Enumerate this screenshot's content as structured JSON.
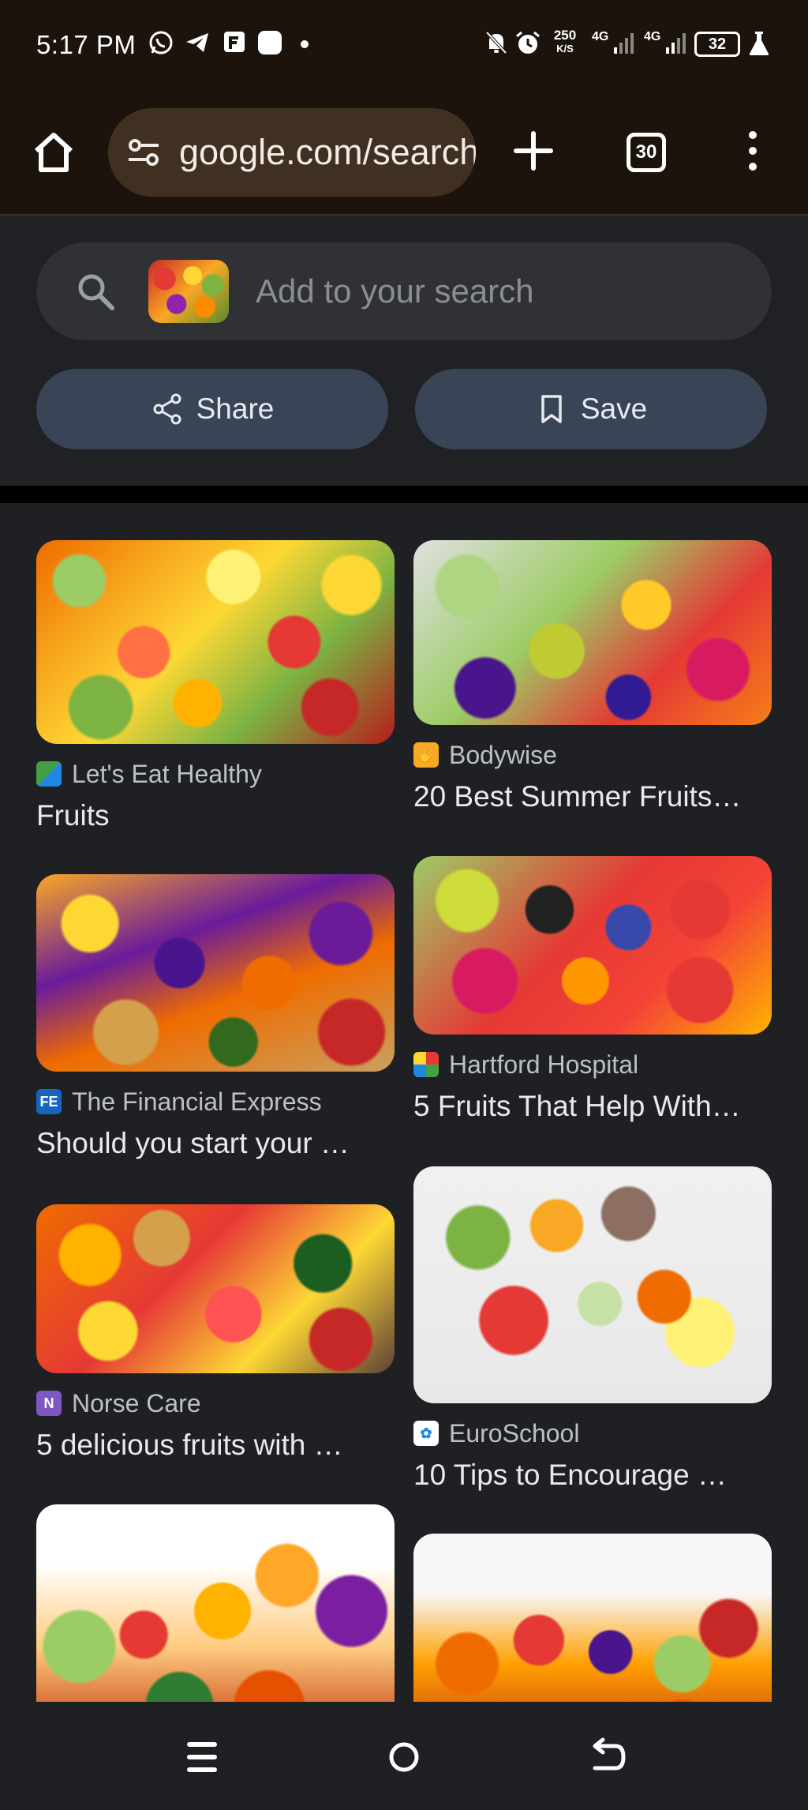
{
  "status_bar": {
    "time": "5:17 PM",
    "net_speed_value": "250",
    "net_speed_unit": "K/S",
    "sim1": "4G",
    "sim2": "4G",
    "battery": "32",
    "left_icons": [
      "whatsapp-icon",
      "telegram-icon",
      "flipboard-icon",
      "app-square-icon",
      "dot-icon"
    ],
    "right_icons": [
      "mute-icon",
      "alarm-icon",
      "signal-icon",
      "battery-icon",
      "flask-icon"
    ]
  },
  "toolbar": {
    "url": "google.com/search",
    "tab_count": "30"
  },
  "lens": {
    "search_placeholder": "Add to your search",
    "share_label": "Share",
    "save_label": "Save"
  },
  "results": [
    {
      "source": "Let's Eat Healthy",
      "title": "Fruits",
      "favicon_color": "#1e88e5"
    },
    {
      "source": "Bodywise",
      "title": "20 Best Summer Fruits…",
      "favicon_color": "#f9a825"
    },
    {
      "source": "The Financial Express",
      "title": "Should you start your …",
      "favicon_text": "FE",
      "favicon_color": "#1565c0"
    },
    {
      "source": "Hartford Hospital",
      "title": "5 Fruits That Help With…",
      "favicon_color": "#ffffff"
    },
    {
      "source": "Norse Care",
      "title": "5 delicious fruits with …",
      "favicon_color": "#7e57c2"
    },
    {
      "source": "EuroSchool",
      "title": "10 Tips to Encourage …",
      "favicon_color": "#ffffff"
    }
  ],
  "colors": {
    "browser_chrome": "#1c140c",
    "omnibox": "#3f3022",
    "panel_bg": "#202124",
    "pill_bg": "#394457",
    "page_bg": "#1f2023"
  }
}
